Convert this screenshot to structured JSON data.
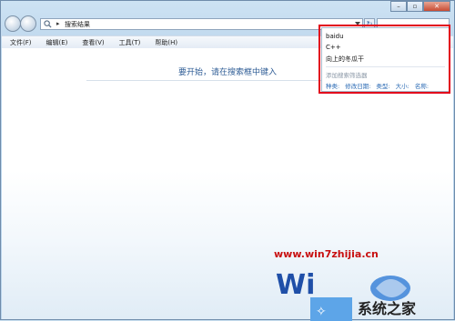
{
  "address": {
    "text": "搜索结果",
    "separator": "▸"
  },
  "menus": [
    "文件(F)",
    "编辑(E)",
    "查看(V)",
    "工具(T)",
    "帮助(H)"
  ],
  "content": {
    "hint": "要开始，请在搜索框中键入"
  },
  "dropdown": {
    "history": [
      "baidu",
      "C++",
      "向上的冬瓜干"
    ],
    "add_filter": "添加搜索筛选器",
    "filters": [
      "种类:",
      "修改日期:",
      "类型:",
      "大小:",
      "名称:"
    ]
  },
  "watermark": {
    "url": "www.win7zhijia.cn",
    "logo_text": "系统之家"
  },
  "colors": {
    "highlight": "#e2001a",
    "link": "#2a6ab4",
    "hint": "#2f5d96"
  }
}
